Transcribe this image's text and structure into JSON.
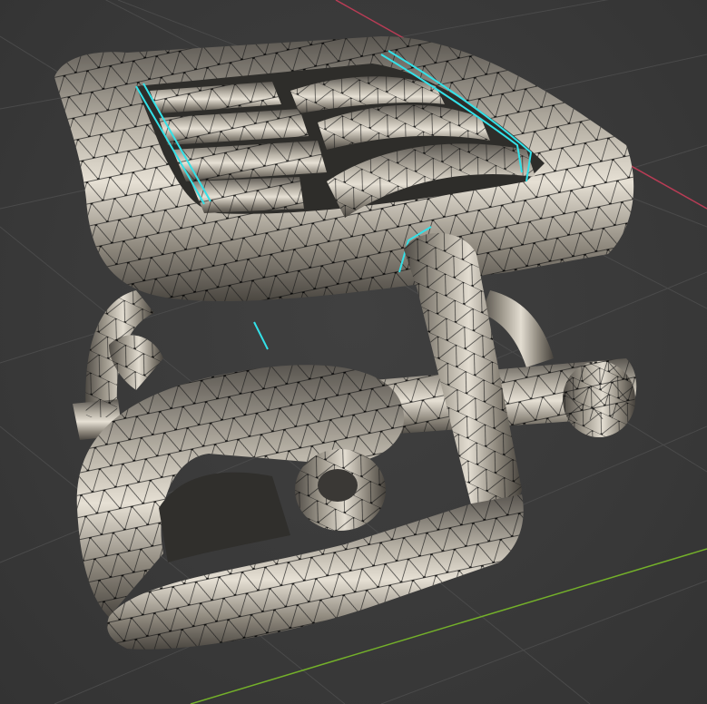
{
  "viewport": {
    "background_color": "#393939",
    "grid_color": "#4a4a4a",
    "x_axis_color": "#c2405a",
    "y_axis_color": "#7fbf2f"
  },
  "mesh": {
    "surface_color": "#a9a398",
    "highlight_color": "#ece6da",
    "shadow_color": "#4e4a44",
    "wire_color": "#141414",
    "vertex_color": "#000000",
    "selected_edge_color": "#33e1e8",
    "display_mode": "solid-wireframe-edit"
  }
}
